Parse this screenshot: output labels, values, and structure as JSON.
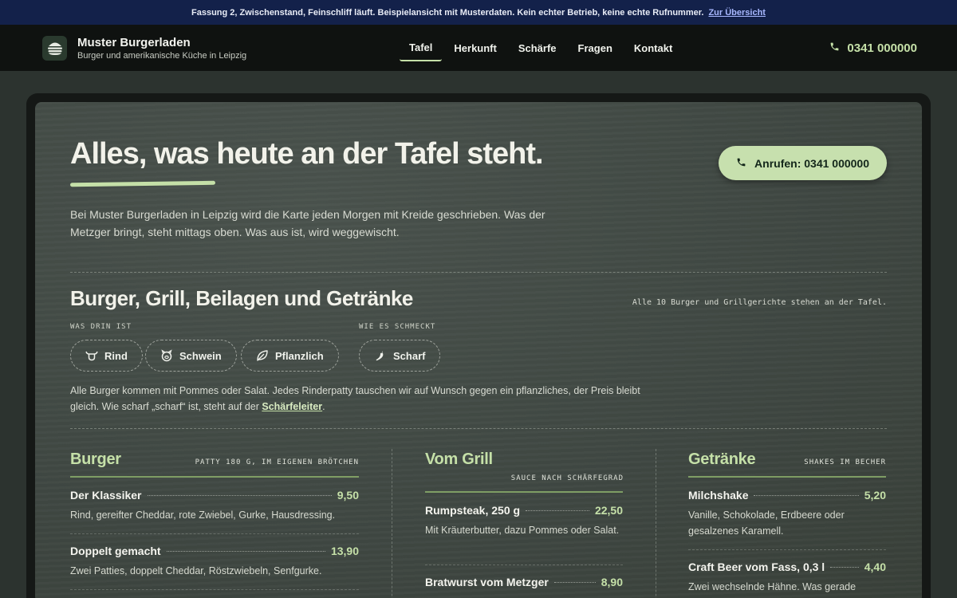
{
  "notice": {
    "text": "Fassung 2, Zwischenstand, Feinschliff läuft. Beispielansicht mit Musterdaten. Kein echter Betrieb, keine echte Rufnummer.",
    "link": "Zur Übersicht"
  },
  "header": {
    "brand_name": "Muster Burgerladen",
    "brand_sub": "Burger und amerikanische Küche in Leipzig",
    "nav": [
      "Tafel",
      "Herkunft",
      "Schärfe",
      "Fragen",
      "Kontakt"
    ],
    "phone": "0341 000000"
  },
  "hero": {
    "title": "Alles, was heute an der Tafel steht.",
    "call_button": "Anrufen: 0341 000000",
    "intro": "Bei Muster Burgerladen in Leipzig wird die Karte jeden Morgen mit Kreide geschrieben. Was der Metzger bringt, steht mittags oben. Was aus ist, wird weggewischt."
  },
  "menu_section": {
    "title": "Burger, Grill, Beilagen und Getränke",
    "note": "Alle 10 Burger und Grillgerichte stehen an der Tafel.",
    "filter_label_1": "WAS DRIN IST",
    "filter_label_2": "WIE ES SCHMECKT",
    "chips": [
      "Rind",
      "Schwein",
      "Pflanzlich",
      "Scharf"
    ],
    "legend_before": "Alle Burger kommen mit Pommes oder Salat. Jedes Rinderpatty tauschen wir auf Wunsch gegen ein pflanzliches, der Preis bleibt gleich. Wie scharf „scharf“ ist, steht auf der ",
    "legend_link": "Schärfeleiter",
    "legend_after": "."
  },
  "columns": {
    "burger": {
      "title": "Burger",
      "sub": "PATTY 180 G, IM EIGENEN BRÖTCHEN",
      "items": [
        {
          "name": "Der Klassiker",
          "price": "9,50",
          "desc": "Rind, gereifter Cheddar, rote Zwiebel, Gurke, Hausdressing."
        },
        {
          "name": "Doppelt gemacht",
          "price": "13,90",
          "desc": "Zwei Patties, doppelt Cheddar, Röstzwiebeln, Senfgurke."
        }
      ]
    },
    "grill": {
      "title": "Vom Grill",
      "sub": "SAUCE NACH SCHÄRFEGRAD",
      "items": [
        {
          "name": "Rumpsteak, 250 g",
          "price": "22,50",
          "desc": "Mit Kräuterbutter, dazu Pommes oder Salat."
        },
        {
          "name": "Bratwurst vom Metzger",
          "price": "8,90",
          "desc": ""
        }
      ]
    },
    "drinks": {
      "title": "Getränke",
      "sub": "SHAKES IM BECHER",
      "items": [
        {
          "name": "Milchshake",
          "price": "5,20",
          "desc": "Vanille, Schokolade, Erdbeere oder gesalzenes Karamell."
        },
        {
          "name": "Craft Beer vom Fass, 0,3 l",
          "price": "4,40",
          "desc": "Zwei wechselnde Hähne. Was gerade"
        }
      ]
    }
  },
  "colors": {
    "accent": "#c5e0a8",
    "board": "#3f4742",
    "header": "#0f1210",
    "notice_bar": "#13214a"
  }
}
